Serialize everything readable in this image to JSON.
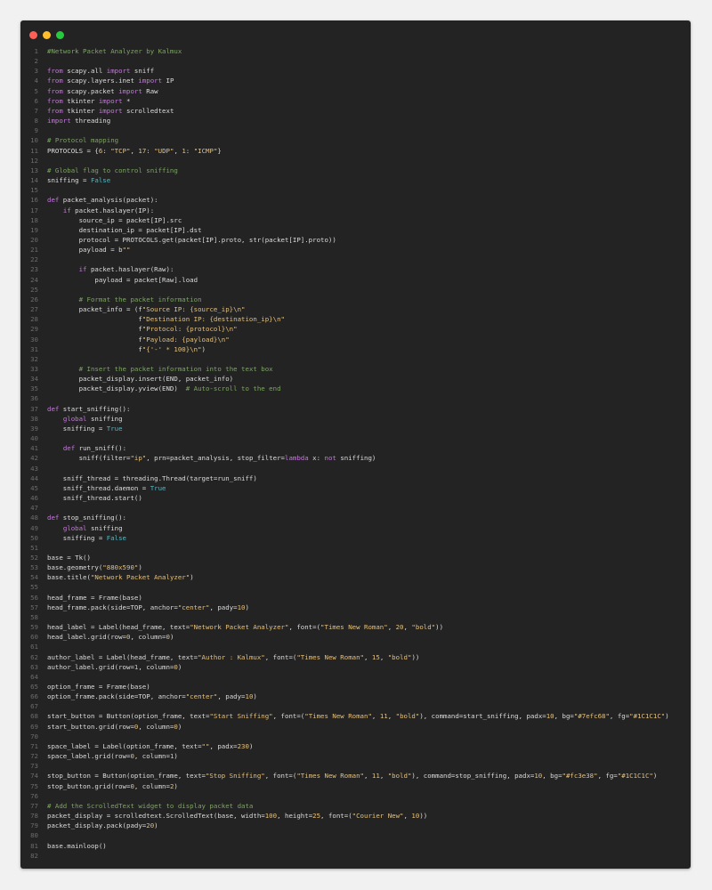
{
  "window": {
    "controls": [
      "close",
      "minimize",
      "maximize"
    ]
  },
  "code_lines": [
    "#Network Packet Analyzer by Kalmux",
    "",
    "from scapy.all import sniff",
    "from scapy.layers.inet import IP",
    "from scapy.packet import Raw",
    "from tkinter import *",
    "from tkinter import scrolledtext",
    "import threading",
    "",
    "# Protocol mapping",
    "PROTOCOLS = {6: \"TCP\", 17: \"UDP\", 1: \"ICMP\"}",
    "",
    "# Global flag to control sniffing",
    "sniffing = False",
    "",
    "def packet_analysis(packet):",
    "    if packet.haslayer(IP):",
    "        source_ip = packet[IP].src",
    "        destination_ip = packet[IP].dst",
    "        protocol = PROTOCOLS.get(packet[IP].proto, str(packet[IP].proto))",
    "        payload = b\"\"",
    "",
    "        if packet.haslayer(Raw):",
    "            payload = packet[Raw].load",
    "",
    "        # Format the packet information",
    "        packet_info = (f\"Source IP: {source_ip}\\n\"",
    "                       f\"Destination IP: {destination_ip}\\n\"",
    "                       f\"Protocol: {protocol}\\n\"",
    "                       f\"Payload: {payload}\\n\"",
    "                       f\"{'-' * 100}\\n\")",
    "",
    "        # Insert the packet information into the text box",
    "        packet_display.insert(END, packet_info)",
    "        packet_display.yview(END)  # Auto-scroll to the end",
    "",
    "def start_sniffing():",
    "    global sniffing",
    "    sniffing = True",
    "",
    "    def run_sniff():",
    "        sniff(filter=\"ip\", prn=packet_analysis, stop_filter=lambda x: not sniffing)",
    "",
    "    sniff_thread = threading.Thread(target=run_sniff)",
    "    sniff_thread.daemon = True",
    "    sniff_thread.start()",
    "",
    "def stop_sniffing():",
    "    global sniffing",
    "    sniffing = False",
    "",
    "base = Tk()",
    "base.geometry(\"880x590\")",
    "base.title(\"Network Packet Analyzer\")",
    "",
    "head_frame = Frame(base)",
    "head_frame.pack(side=TOP, anchor=\"center\", pady=10)",
    "",
    "head_label = Label(head_frame, text=\"Network Packet Analyzer\", font=(\"Times New Roman\", 20, \"bold\"))",
    "head_label.grid(row=0, column=0)",
    "",
    "author_label = Label(head_frame, text=\"Author : Kalmux\", font=(\"Times New Roman\", 15, \"bold\"))",
    "author_label.grid(row=1, column=0)",
    "",
    "option_frame = Frame(base)",
    "option_frame.pack(side=TOP, anchor=\"center\", pady=10)",
    "",
    "start_button = Button(option_frame, text=\"Start Sniffing\", font=(\"Times New Roman\", 11, \"bold\"), command=start_sniffing, padx=10, bg=\"#7efc68\", fg=\"#1C1C1C\")",
    "start_button.grid(row=0, column=0)",
    "",
    "space_label = Label(option_frame, text=\"\", padx=230)",
    "space_label.grid(row=0, column=1)",
    "",
    "stop_button = Button(option_frame, text=\"Stop Sniffing\", font=(\"Times New Roman\", 11, \"bold\"), command=stop_sniffing, padx=10, bg=\"#fc3e38\", fg=\"#1C1C1C\")",
    "stop_button.grid(row=0, column=2)",
    "",
    "# Add the ScrolledText widget to display packet data",
    "packet_display = scrolledtext.ScrolledText(base, width=100, height=25, font=(\"Courier New\", 10))",
    "packet_display.pack(pady=20)",
    "",
    "base.mainloop()",
    ""
  ],
  "colors": {
    "window_bg": "#232323",
    "page_bg": "#f1f1f1",
    "keyword": "#c678dd",
    "string": "#e5c07b",
    "comment": "#7ca563",
    "line_number": "#6c6c6c"
  }
}
